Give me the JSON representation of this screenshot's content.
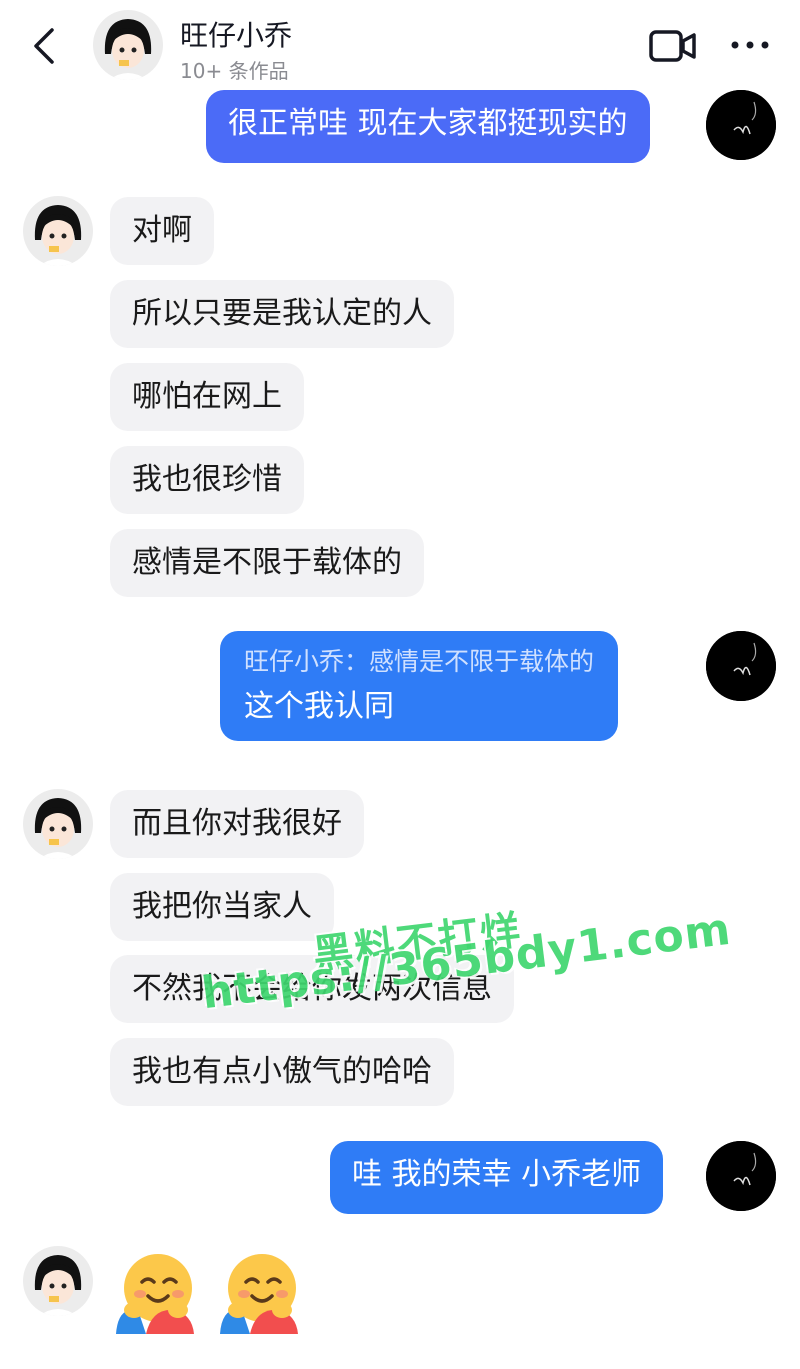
{
  "header": {
    "contact_name": "旺仔小乔",
    "works_count": "10+ 条作品",
    "back_icon": "chevron-left-icon",
    "video_icon": "video-camera-icon",
    "more_icon": "more-horizontal-icon"
  },
  "messages": [
    {
      "side": "sent",
      "text": "很正常哇 现在大家都挺现实的"
    },
    {
      "side": "recv",
      "text": "对啊"
    },
    {
      "side": "recv",
      "text": "所以只要是我认定的人"
    },
    {
      "side": "recv",
      "text": "哪怕在网上"
    },
    {
      "side": "recv",
      "text": "我也很珍惜"
    },
    {
      "side": "recv",
      "text": "感情是不限于载体的"
    },
    {
      "side": "sent",
      "quote": "旺仔小乔：感情是不限于载体的",
      "text": "这个我认同"
    },
    {
      "side": "recv",
      "text": "而且你对我很好"
    },
    {
      "side": "recv",
      "text": "我把你当家人"
    },
    {
      "side": "recv",
      "text": "不然我不会给你发两次信息"
    },
    {
      "side": "recv",
      "text": "我也有点小傲气的哈哈"
    },
    {
      "side": "sent",
      "text": "哇 我的荣幸 小乔老师"
    },
    {
      "side": "recv",
      "emoji": [
        "hugging-face-icon",
        "hugging-face-icon"
      ]
    }
  ],
  "watermark": {
    "line1": "黑料不打烊",
    "line2": "https://365bdy1.com"
  },
  "colors": {
    "sent_bubble": "#4b6bf7",
    "sent_bubble_quote": "#2f7cf6",
    "recv_bubble": "#f2f2f4",
    "watermark": "#3fd66f"
  }
}
